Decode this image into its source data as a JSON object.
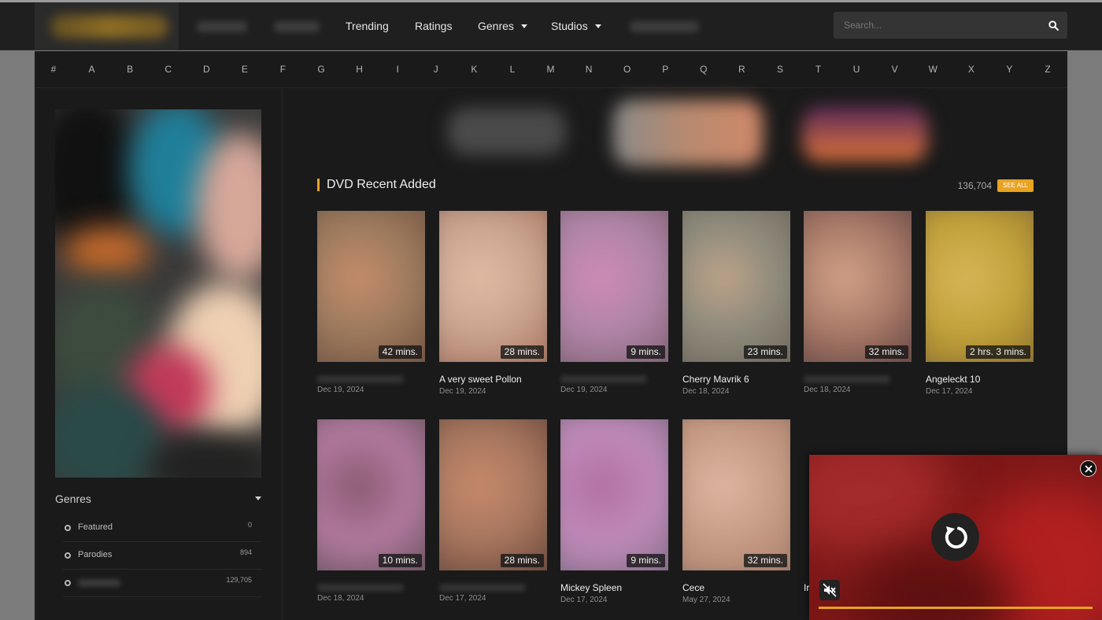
{
  "nav": {
    "items": [
      {
        "label": "Trending"
      },
      {
        "label": "Ratings"
      },
      {
        "label": "Genres"
      },
      {
        "label": "Studios"
      }
    ],
    "search_placeholder": "Search..."
  },
  "alphabet": [
    "#",
    "A",
    "B",
    "C",
    "D",
    "E",
    "F",
    "G",
    "H",
    "I",
    "J",
    "K",
    "L",
    "M",
    "N",
    "O",
    "P",
    "Q",
    "R",
    "S",
    "T",
    "U",
    "V",
    "W",
    "X",
    "Y",
    "Z"
  ],
  "sidebar": {
    "genres_title": "Genres",
    "genres": [
      {
        "name": "Featured",
        "count": "0"
      },
      {
        "name": "Parodies",
        "count": "894"
      },
      {
        "name": "",
        "count": "129,705"
      }
    ]
  },
  "section": {
    "title": "DVD Recent Added",
    "count": "136,704",
    "see_all": "SEE ALL"
  },
  "cards": [
    {
      "title": "",
      "date": "Dec 19, 2024",
      "duration": "42 mins."
    },
    {
      "title": "A very sweet Pollon",
      "date": "Dec 19, 2024",
      "duration": "28 mins."
    },
    {
      "title": "",
      "date": "Dec 19, 2024",
      "duration": "9 mins."
    },
    {
      "title": "Cherry Mavrik 6",
      "date": "Dec 18, 2024",
      "duration": "23 mins."
    },
    {
      "title": "",
      "date": "Dec 18, 2024",
      "duration": "32 mins."
    },
    {
      "title": "Angeleckt 10",
      "date": "Dec 17, 2024",
      "duration": "2 hrs. 3 mins."
    },
    {
      "title": "",
      "date": "Dec 18, 2024",
      "duration": "10 mins."
    },
    {
      "title": "",
      "date": "Dec 17, 2024",
      "duration": "28 mins."
    },
    {
      "title": "Mickey Spleen",
      "date": "Dec 17, 2024",
      "duration": "9 mins."
    },
    {
      "title": "Cece",
      "date": "May 27, 2024",
      "duration": "32 mins."
    }
  ],
  "video": {
    "peek_title": "Ir",
    "progress": 1.0
  },
  "icons": {
    "search": "search-icon",
    "replay": "replay-icon",
    "mute": "mute-icon",
    "close": "close-icon"
  },
  "colors": {
    "accent": "#e8a321",
    "background": "#1a1a1a",
    "navbar": "#1f1f1f",
    "video": "#7c1717"
  }
}
